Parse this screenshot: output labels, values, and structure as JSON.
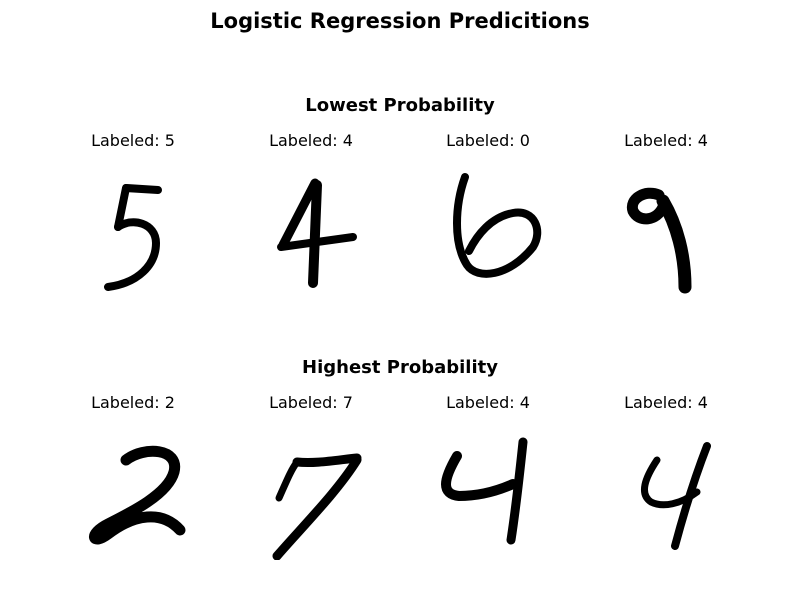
{
  "title": "Logistic Regression Predicitions",
  "sections": [
    {
      "title": "Lowest Probability",
      "cells": [
        {
          "label": "Labeled: 5",
          "glyph": "5"
        },
        {
          "label": "Labeled: 4",
          "glyph": "4"
        },
        {
          "label": "Labeled: 0",
          "glyph": "6"
        },
        {
          "label": "Labeled: 4",
          "glyph": "9"
        }
      ]
    },
    {
      "title": "Highest Probability",
      "cells": [
        {
          "label": "Labeled: 2",
          "glyph": "2"
        },
        {
          "label": "Labeled: 7",
          "glyph": "7"
        },
        {
          "label": "Labeled: 4",
          "glyph": "4"
        },
        {
          "label": "Labeled: 4",
          "glyph": "4"
        }
      ]
    }
  ]
}
